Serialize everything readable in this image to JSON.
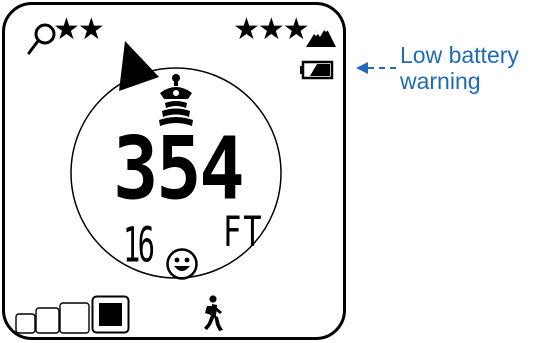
{
  "device": {
    "left_stars": "★★",
    "right_stars": "★★★",
    "distance_value": "354",
    "distance_unit": "FT",
    "small_number": "16",
    "icons": {
      "search": "magnifier-icon",
      "direction": "direction-pointer-icon",
      "mountain": "mountain-icon",
      "battery": "low-battery-icon",
      "signal": "signal-beacon-icon",
      "smiley": "smiley-face-icon",
      "walker": "walking-person-icon"
    },
    "boxes": [
      {
        "filled": false
      },
      {
        "filled": false
      },
      {
        "filled": false
      },
      {
        "filled": true
      }
    ]
  },
  "callout": {
    "line1": "Low battery",
    "line2": "warning",
    "color": "#1f6bb8"
  }
}
